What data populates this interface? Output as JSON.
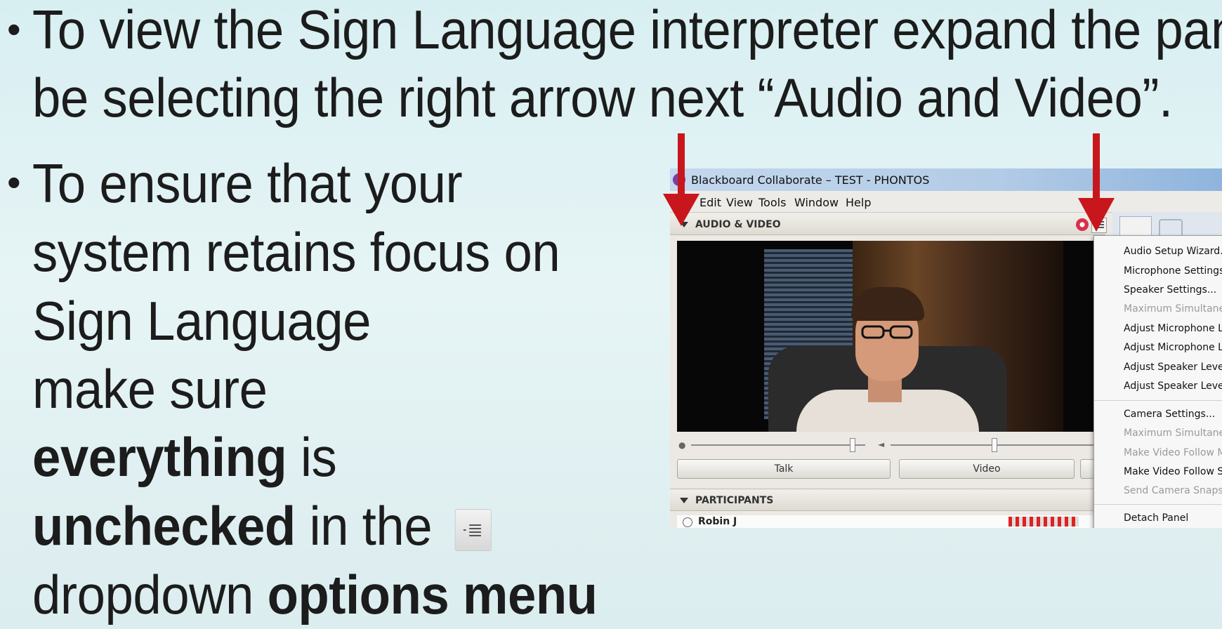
{
  "slide": {
    "bullet1_line1": "To view the Sign Language interpreter expand the panel",
    "bullet1_line2": "be selecting the right arrow next “Audio and Video”.",
    "bullet2_line1": "To ensure that your",
    "bullet2_line2": "system retains focus on",
    "bullet2_line3": "Sign Language",
    "bullet2_line4": "make sure",
    "bullet2_bold1": "everything",
    "bullet2_text1": " is",
    "bullet2_bold2": "unchecked",
    "bullet2_text2": " in the ",
    "bullet2_line7_text": "dropdown ",
    "bullet2_bold3": "options menu"
  },
  "window": {
    "title": "Blackboard Collaborate – TEST - PHONTOS",
    "menu": [
      "Edit",
      "View",
      "Tools",
      "Window",
      "Help"
    ]
  },
  "audio_video": {
    "panel_label": "AUDIO & VIDEO",
    "talk_label": "Talk",
    "video_label": "Video"
  },
  "participants": {
    "panel_label": "PARTICIPANTS",
    "first_name": "Robin J"
  },
  "dropdown_menu": [
    {
      "label": "Audio Setup Wizard...",
      "enabled": true
    },
    {
      "label": "Microphone Settings...",
      "enabled": true
    },
    {
      "label": "Speaker Settings...",
      "enabled": true
    },
    {
      "label": "Maximum Simultaneous",
      "enabled": false
    },
    {
      "label": "Adjust Microphone Le",
      "enabled": true
    },
    {
      "label": "Adjust Microphone Le",
      "enabled": true
    },
    {
      "label": "Adjust Speaker Level U",
      "enabled": true
    },
    {
      "label": "Adjust Speaker Level D",
      "enabled": true
    },
    {
      "label": "Camera Settings...",
      "enabled": true
    },
    {
      "label": "Maximum Simultaneous",
      "enabled": false
    },
    {
      "label": "Make Video Follow Mo",
      "enabled": false
    },
    {
      "label": "Make Video Follow Sp",
      "enabled": true
    },
    {
      "label": "Send Camera Snapsho",
      "enabled": false
    },
    {
      "label": "Detach Panel",
      "enabled": true
    }
  ],
  "colors": {
    "arrow": "#c8161d",
    "title_bar": "#b2cbe6",
    "slide_bg": "#e1f2f3"
  },
  "icons": {
    "options": "options-menu-icon",
    "settings": "gear-icon"
  }
}
